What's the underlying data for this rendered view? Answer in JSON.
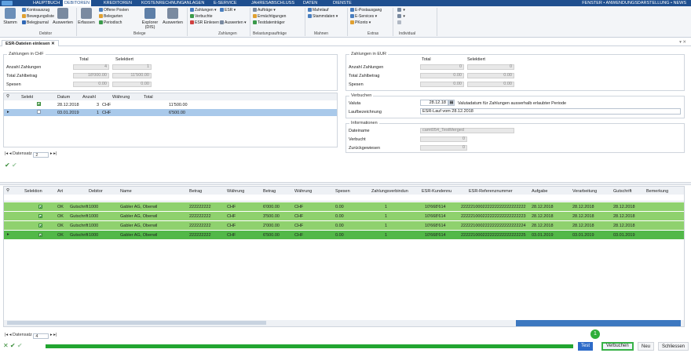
{
  "menubar": {
    "items": [
      "HAUPTBUCH",
      "DEBITOREN",
      "KREDITOREN",
      "KOSTENRECHNUNG",
      "ANLAGEN",
      "E-SERVICE",
      "JAHRESABSCHLUSS",
      "DATEN",
      "DIENSTE"
    ],
    "right": "FENSTER  •  ANWENDUNGSDARSTELLUNG  •  NEWS"
  },
  "ribbon": {
    "stamm": "Stamm",
    "kontoauszug": "Kontoauszug",
    "bewegungsliste": "Bewegungsliste",
    "belegjournal": "Belegjournal",
    "auswerten1": "Auswerten",
    "debitor": "Debitor",
    "erfassen": "Erfassen",
    "offene_posten": "Offene Posten",
    "belegarten": "Belegarten",
    "periodisch": "Periodisch",
    "explorer": "Explorer (DIS)",
    "auswerten2": "Auswerten",
    "belege": "Belege",
    "zahlungen": "Zahlungen",
    "esr": "ESR",
    "verbuchte": "Verbuchte",
    "esr_einlesen": "ESR Einlesen",
    "auswerten3": "Auswerten",
    "zahlungen_grp": "Zahlungen",
    "auftraege": "Aufträge",
    "ermaechtigungen": "Ermächtigungen",
    "testdatentraeger": "Testdatenträger",
    "belastung_grp": "Belastungsaufträge",
    "mahnlauf": "Mahnlauf",
    "stammdaten": "Stammdaten",
    "mahnen_grp": "Mahnen",
    "e_postausgang": "E-Postausgang",
    "e_services": "E-Services",
    "pkonto": "PKonto",
    "extras_grp": "Extras",
    "individual_grp": "Individual"
  },
  "tab": {
    "label": "ESR-Dateien einlesen"
  },
  "chf": {
    "legend": "Zahlungen in CHF",
    "col_total": "Total",
    "col_sel": "Selektiert",
    "rows": [
      {
        "label": "Anzahl Zahlungen",
        "total": "4",
        "sel": "1"
      },
      {
        "label": "Total Zahlbetrag",
        "total": "18'000.00",
        "sel": "11'500.00"
      },
      {
        "label": "Spesen",
        "total": "0.00",
        "sel": "0.00"
      }
    ]
  },
  "eur": {
    "legend": "Zahlungen in EUR",
    "col_total": "Total",
    "col_sel": "Selektiert",
    "rows": [
      {
        "label": "Anzahl Zahlungen",
        "total": "0",
        "sel": "0"
      },
      {
        "label": "Total Zahlbetrag",
        "total": "0.00",
        "sel": "0.00"
      },
      {
        "label": "Spesen",
        "total": "0.00",
        "sel": "0.00"
      }
    ]
  },
  "verbuchen": {
    "legend": "Verbuchen",
    "valuta_label": "Valuta",
    "valuta": "28.12.18",
    "valuta_hint": "Valutadatum für Zahlungen ausserhalb erlaubter Periode",
    "lauf_label": "Laufbezeichnung",
    "lauf": "ESR-Lauf vom 28.12.2018"
  },
  "info": {
    "legend": "Informationen",
    "datei_label": "Dateiname",
    "datei": "camt054_TestMerged",
    "verbucht_label": "Verbucht",
    "verbucht": "0",
    "zur_label": "Zurückgewiesen",
    "zur": "0"
  },
  "small_grid": {
    "headers": [
      "Selekt",
      "Datum",
      "Anzahl",
      "Währung",
      "Total"
    ],
    "rows": [
      {
        "datum": "28.12.2018",
        "anzahl": "3",
        "whg": "CHF",
        "total": "11'500.00"
      },
      {
        "datum": "03.01.2019",
        "anzahl": "1",
        "whg": "CHF",
        "total": "6'500.00"
      }
    ],
    "nav_label": "Datensatz",
    "nav_value": "2"
  },
  "main_grid": {
    "headers": [
      "Selektion",
      "Art",
      "Debitor",
      "Name",
      "Betrag",
      "Währung",
      "Betrag",
      "Währung",
      "Spesen",
      "Zahlungsverbindun",
      "ESR-Kundennu",
      "ESR-Referenznummer",
      "Aufgabe",
      "Verarbeitung",
      "Gutschrift",
      "Bemerkung"
    ],
    "rows": [
      {
        "status": "OK",
        "art": "Gutschrift",
        "debitor": "1000",
        "name": "Gabler AG, Oberwil",
        "betrag": "222222222",
        "whg": "CHF",
        "betrag2": "6'000.00",
        "whg2": "CHF",
        "spesen": "0.00",
        "zv": "1",
        "esr_kn": "10'668'614",
        "ref": "222221000222222222222222222",
        "aufgabe": "28.12.2018",
        "verarb": "28.12.2018",
        "gut": "28.12.2018"
      },
      {
        "status": "OK",
        "art": "Gutschrift",
        "debitor": "1000",
        "name": "Gabler AG, Oberwil",
        "betrag": "222222222",
        "whg": "CHF",
        "betrag2": "3'500.00",
        "whg2": "CHF",
        "spesen": "0.00",
        "zv": "1",
        "esr_kn": "10'668'614",
        "ref": "222221000222222222222222223",
        "aufgabe": "28.12.2018",
        "verarb": "28.12.2018",
        "gut": "28.12.2018"
      },
      {
        "status": "OK",
        "art": "Gutschrift",
        "debitor": "1000",
        "name": "Gabler AG, Oberwil",
        "betrag": "222222222",
        "whg": "CHF",
        "betrag2": "2'000.00",
        "whg2": "CHF",
        "spesen": "0.00",
        "zv": "1",
        "esr_kn": "10'668'614",
        "ref": "222221000222222222222222224",
        "aufgabe": "28.12.2018",
        "verarb": "28.12.2018",
        "gut": "28.12.2018"
      },
      {
        "status": "OK",
        "art": "Gutschrift",
        "debitor": "1000",
        "name": "Gabler AG, Oberwil",
        "betrag": "222222222",
        "whg": "CHF",
        "betrag2": "6'500.00",
        "whg2": "CHF",
        "spesen": "0.00",
        "zv": "1",
        "esr_kn": "10'668'614",
        "ref": "222221000222222222222222225",
        "aufgabe": "03.01.2019",
        "verarb": "03.01.2019",
        "gut": "03.01.2019"
      }
    ],
    "nav_label": "Datensatz",
    "nav_value": "4"
  },
  "bottom": {
    "progress": 1.0,
    "test": "Test",
    "verbuchen": "Verbuchen",
    "neu": "Neu",
    "schliessen": "Schliessen",
    "badge": "1"
  },
  "colors": {
    "menubar": "#1f4f8f",
    "row_green": "#8fd16e",
    "row_selected": "#52b848",
    "progress": "#22a531",
    "test_button": "#2d6bc8"
  }
}
